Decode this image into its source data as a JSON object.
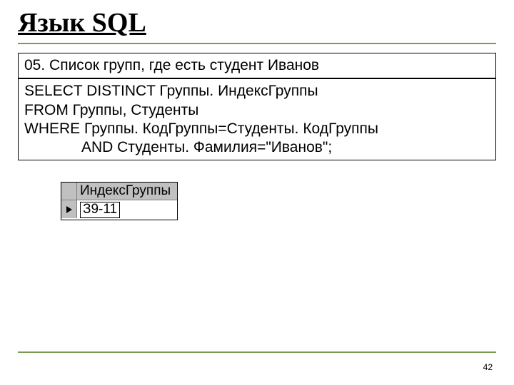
{
  "title": "Язык SQL",
  "task": "05. Список групп, где есть студент Иванов",
  "sql_line1": "SELECT DISTINCT  Группы. ИндексГруппы",
  "sql_line2": "FROM Группы, Студенты",
  "sql_line3": "WHERE Группы. КодГруппы=Студенты. КодГруппы",
  "sql_line4": "AND Студенты. Фамилия=\"Иванов\";",
  "grid": {
    "header": "ИндексГруппы",
    "value": "З9-11"
  },
  "page": "42"
}
